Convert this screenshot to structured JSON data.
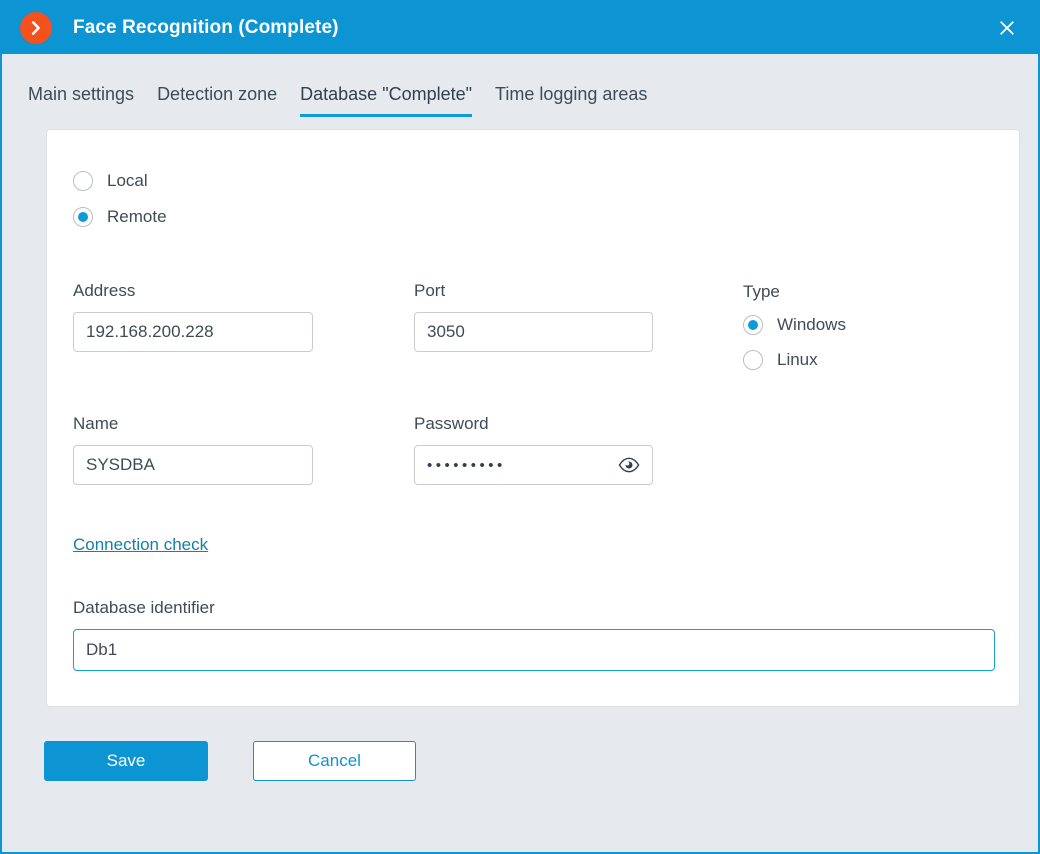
{
  "window": {
    "title": "Face Recognition (Complete)",
    "logo_icon": "chevron-right-circle-icon",
    "close_icon": "close-icon",
    "titlebar_color": "#0d94d2",
    "logo_color": "#f4511e",
    "accent_color": "#0d9cd8",
    "background_color": "#e6eaee"
  },
  "tabs": [
    {
      "label": "Main settings",
      "active": false
    },
    {
      "label": "Detection zone",
      "active": false
    },
    {
      "label": "Database \"Complete\"",
      "active": true
    },
    {
      "label": "Time logging areas",
      "active": false
    }
  ],
  "form": {
    "location": {
      "options": [
        {
          "label": "Local",
          "selected": false
        },
        {
          "label": "Remote",
          "selected": true
        }
      ]
    },
    "address": {
      "label": "Address",
      "value": "192.168.200.228",
      "placeholder": ""
    },
    "port": {
      "label": "Port",
      "value": "3050",
      "placeholder": ""
    },
    "type": {
      "label": "Type",
      "options": [
        {
          "label": "Windows",
          "selected": true
        },
        {
          "label": "Linux",
          "selected": false
        }
      ]
    },
    "name": {
      "label": "Name",
      "value": "SYSDBA",
      "placeholder": ""
    },
    "password": {
      "label": "Password",
      "value": "•••••••••",
      "placeholder": "",
      "reveal_icon": "eye-icon"
    },
    "connection_check": {
      "label": "Connection check"
    },
    "database_identifier": {
      "label": "Database identifier",
      "value": "Db1",
      "placeholder": "",
      "focused": true
    }
  },
  "footer": {
    "save_label": "Save",
    "cancel_label": "Cancel"
  }
}
